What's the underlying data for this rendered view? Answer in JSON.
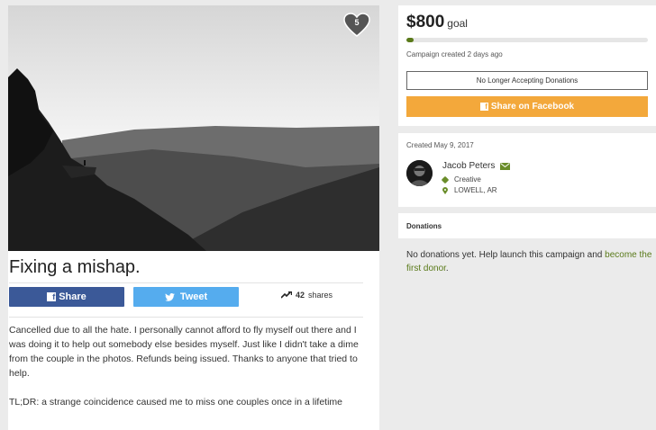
{
  "campaign": {
    "favorite_count": "5",
    "title": "Fixing a mishap.",
    "share_facebook_label": "Share",
    "tweet_label": "Tweet",
    "shares_count": "42",
    "shares_suffix": "shares",
    "story_paragraph_1": "Cancelled due to all the hate. I personally cannot afford to fly myself out there and I was doing it to help out somebody else besides myself. Just like I didn't take a dime from the couple in the photos.  Refunds being issued. Thanks to anyone that tried to help.",
    "story_paragraph_2": "TL;DR: a strange coincidence caused me to miss one couples once in a lifetime"
  },
  "funding": {
    "amount": "$800",
    "goal_label": "goal",
    "progress_fraction": 0.03,
    "created_text": "Campaign created 2 days ago",
    "status_button": "No Longer Accepting Donations",
    "share_button": "Share on Facebook"
  },
  "organizer": {
    "created_date": "Created May 9, 2017",
    "name": "Jacob Peters",
    "category": "Creative",
    "location": "LOWELL, AR"
  },
  "donations": {
    "header": "Donations",
    "empty_text": "No donations yet. Help launch this campaign and ",
    "empty_link": "become the first donor",
    "empty_end": "."
  },
  "colors": {
    "facebook": "#3b5998",
    "twitter": "#55acee",
    "accent_orange": "#f3a83b",
    "accent_green": "#5a7a1a"
  }
}
